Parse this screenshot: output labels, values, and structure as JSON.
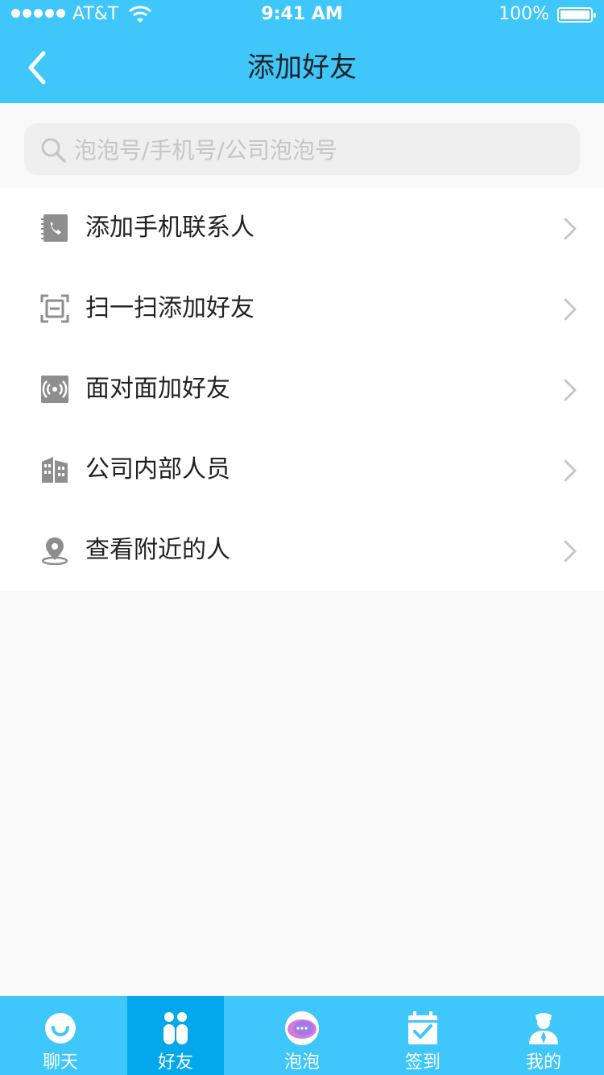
{
  "status_bar": {
    "carrier": "AT&T",
    "time": "9:41 AM",
    "battery": "100%"
  },
  "nav": {
    "title": "添加好友"
  },
  "search": {
    "placeholder": "泡泡号/手机号/公司泡泡号",
    "value": ""
  },
  "menu": [
    {
      "label": "添加手机联系人",
      "icon": "phone-contacts-icon"
    },
    {
      "label": "扫一扫添加好友",
      "icon": "scan-icon"
    },
    {
      "label": "面对面加好友",
      "icon": "face-to-face-icon"
    },
    {
      "label": "公司内部人员",
      "icon": "company-building-icon"
    },
    {
      "label": "查看附近的人",
      "icon": "location-pin-icon"
    }
  ],
  "tabs": [
    {
      "label": "聊天",
      "icon": "chat-icon"
    },
    {
      "label": "好友",
      "icon": "friends-icon",
      "active": true
    },
    {
      "label": "泡泡",
      "icon": "bubble-icon"
    },
    {
      "label": "签到",
      "icon": "checkin-calendar-icon"
    },
    {
      "label": "我的",
      "icon": "profile-icon"
    }
  ],
  "colors": {
    "accent": "#3fc6fb",
    "active_tab": "#02a7ec",
    "icon_gray": "#8e8e8e"
  }
}
